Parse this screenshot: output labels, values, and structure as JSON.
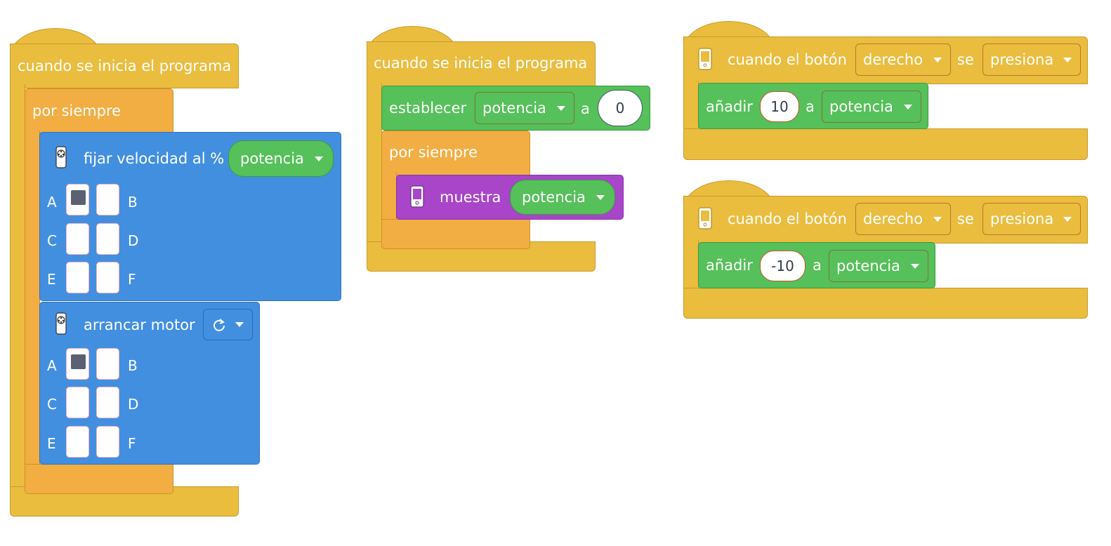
{
  "stack_1": {
    "hat_label": "cuando se inicia el programa",
    "forever_label": "por siempre",
    "set_speed": {
      "label": "fijar velocidad al %",
      "variable": "potencia",
      "ports": [
        {
          "left": "A",
          "left_selected": true,
          "right": "B",
          "right_selected": false
        },
        {
          "left": "C",
          "left_selected": false,
          "right": "D",
          "right_selected": false
        },
        {
          "left": "E",
          "left_selected": false,
          "right": "F",
          "right_selected": false
        }
      ]
    },
    "start_motor": {
      "label": "arrancar motor",
      "direction_icon": "rotate-clockwise-icon",
      "ports": [
        {
          "left": "A",
          "left_selected": true,
          "right": "B",
          "right_selected": false
        },
        {
          "left": "C",
          "left_selected": false,
          "right": "D",
          "right_selected": false
        },
        {
          "left": "E",
          "left_selected": false,
          "right": "F",
          "right_selected": false
        }
      ]
    }
  },
  "stack_2": {
    "hat_label": "cuando se inicia el programa",
    "set_block": {
      "label": "establecer",
      "variable": "potencia",
      "to_label": "a",
      "value": "0"
    },
    "forever_label": "por siempre",
    "show_block": {
      "label": "muestra",
      "variable": "potencia"
    }
  },
  "stack_3": {
    "event": {
      "label": "cuando el botón",
      "button": "derecho",
      "se_label": "se",
      "action": "presiona"
    },
    "add_block": {
      "label": "añadir",
      "value": "10",
      "to_label": "a",
      "variable": "potencia"
    }
  },
  "stack_4": {
    "event": {
      "label": "cuando el botón",
      "button": "derecho",
      "se_label": "se",
      "action": "presiona"
    },
    "add_block": {
      "label": "añadir",
      "value": "-10",
      "to_label": "a",
      "variable": "potencia"
    }
  },
  "colors": {
    "events": "#eabd3f",
    "control": "#f2ae43",
    "motors": "#428fe0",
    "variables": "#56c05a",
    "display": "#a845c9"
  }
}
